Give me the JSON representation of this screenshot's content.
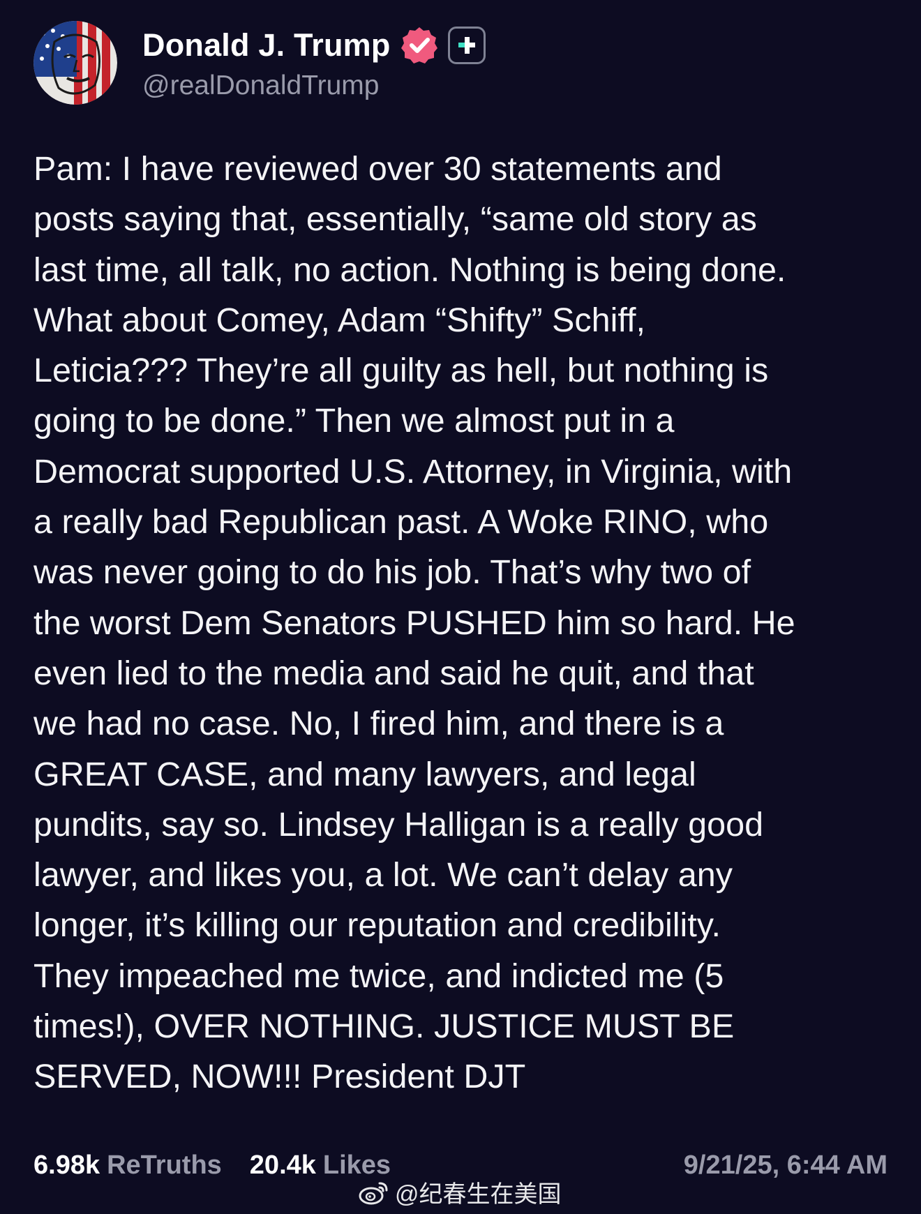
{
  "author": {
    "display_name": "Donald J. Trump",
    "handle": "@realDonaldTrump",
    "avatar_icon": "flag-portrait-avatar",
    "verified_icon": "verified-badge-icon",
    "badge_icon": "plus-badge-icon"
  },
  "post": {
    "text": "Pam: I have reviewed over 30 statements and\nposts saying that, essentially, “same old story as\nlast time, all talk, no action. Nothing is being done.\nWhat about Comey, Adam “Shifty” Schiff,\nLeticia??? They’re all guilty as hell, but nothing is\ngoing to be done.” Then we almost put in a\nDemocrat supported U.S. Attorney, in Virginia, with\na really bad Republican past. A Woke RINO, who\nwas never going to do his job. That’s why two of\nthe worst Dem Senators PUSHED him so hard. He\neven lied to the media and said he quit, and that\nwe had no case. No, I fired him, and there is a\nGREAT CASE, and many lawyers, and legal\npundits, say so. Lindsey Halligan is a really good\nlawyer, and likes you, a lot. We can’t delay any\nlonger, it’s killing our reputation and credibility.\nThey impeached me twice, and indicted me (5\ntimes!), OVER NOTHING. JUSTICE MUST BE\nSERVED, NOW!!! President DJT"
  },
  "stats": {
    "retruths_value": "6.98k",
    "retruths_label": "ReTruths",
    "likes_value": "20.4k",
    "likes_label": "Likes",
    "timestamp": "9/21/25, 6:44 AM"
  },
  "watermark": {
    "text": "@纪春生在美国",
    "icon": "weibo-icon"
  },
  "colors": {
    "background": "#0d0c22",
    "text": "#f4f4f6",
    "muted": "#9a9bab",
    "verified": "#f05a7e",
    "plus_accent": "#3fe0c5"
  }
}
